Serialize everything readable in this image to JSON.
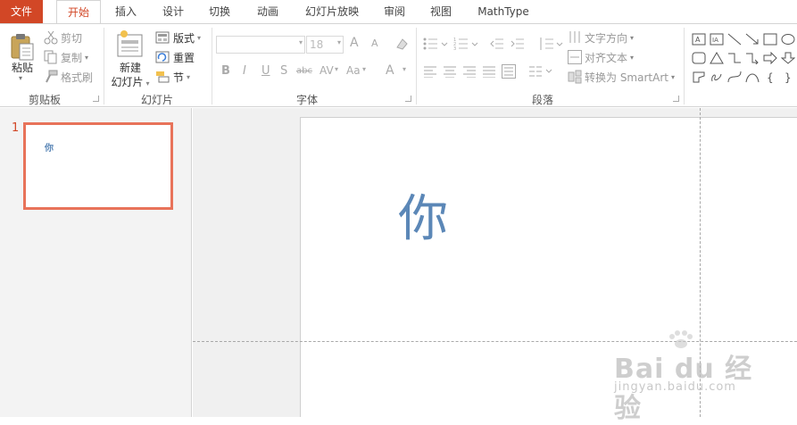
{
  "tabs": [
    {
      "label": "文件"
    },
    {
      "label": "开始"
    },
    {
      "label": "插入"
    },
    {
      "label": "设计"
    },
    {
      "label": "切换"
    },
    {
      "label": "动画"
    },
    {
      "label": "幻灯片放映"
    },
    {
      "label": "审阅"
    },
    {
      "label": "视图"
    },
    {
      "label": "MathType"
    }
  ],
  "clipboard": {
    "paste": "粘贴",
    "cut": "剪切",
    "copy": "复制",
    "format_painter": "格式刷",
    "group": "剪贴板"
  },
  "slides_group": {
    "new_slide_line1": "新建",
    "new_slide_line2": "幻灯片",
    "layout": "版式",
    "reset": "重置",
    "section": "节",
    "group": "幻灯片"
  },
  "font": {
    "font_name": "",
    "font_size": "18",
    "group": "字体",
    "bold": "B",
    "italic": "I",
    "underline": "U",
    "shadow": "S",
    "strike": "abc",
    "spacing": "AV",
    "case": "Aa",
    "color": "A",
    "grow": "A",
    "shrink": "A"
  },
  "paragraph": {
    "text_direction": "文字方向",
    "align_text": "对齐文本",
    "smartart": "转换为 SmartArt",
    "group": "段落"
  },
  "thumbnails": [
    {
      "number": "1",
      "text": "你"
    }
  ],
  "slide": {
    "text": "你"
  },
  "watermark": {
    "big": "Bai du 经验",
    "small": "jingyan.baidu.com"
  },
  "colors": {
    "accent": "#d24726",
    "slide_text": "#5b87b7",
    "thumb_border": "#e8735a"
  }
}
